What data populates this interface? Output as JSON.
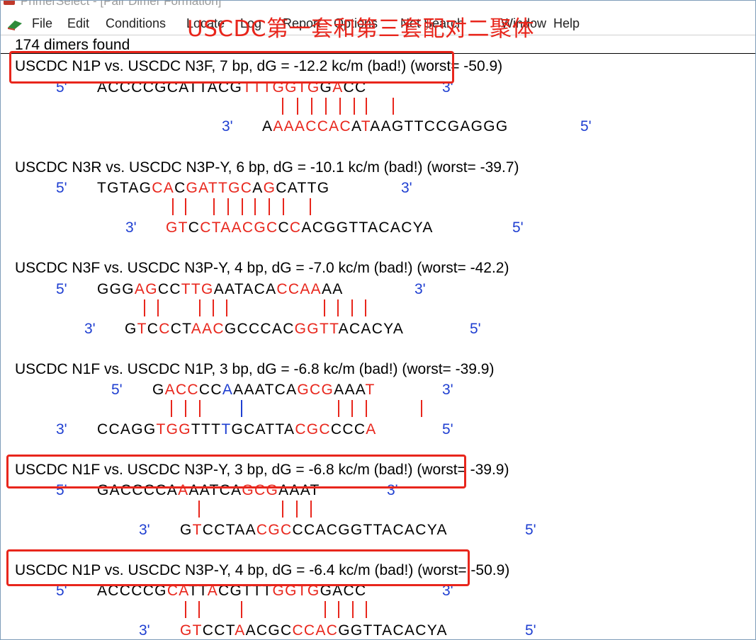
{
  "window": {
    "title": "PrimerSelect - [Pair Dimer Formation]"
  },
  "menu": {
    "items": [
      "File",
      "Edit",
      "Conditions",
      "Locate",
      "Log",
      "Report",
      "Options",
      "Net Search",
      "Window",
      "Help"
    ]
  },
  "annotation": {
    "text": "USCDC第一套和第三套配对二聚体",
    "color": "#e8261c"
  },
  "summary": "174 dimers found",
  "dimers": [
    {
      "header": "USCDC N1P vs. USCDC N3F, 7 bp, dG = -12.2 kc/m (bad!) (worst= -50.9)",
      "top": {
        "prime5": "5'",
        "prime3": "3'",
        "seq": "ACCCCGCATTACGTTTGGTGGACC"
      },
      "bottom": {
        "prime3": "3'",
        "prime5": "5'",
        "seq": "AAAACCACATAAGTTCCGAGGG"
      }
    },
    {
      "header": "USCDC N3R vs. USCDC N3P-Y, 6 bp, dG = -10.1 kc/m (bad!) (worst= -39.7)",
      "top": {
        "prime5": "5'",
        "prime3": "3'",
        "seq": "TGTAGCACGATTGCAGCATTG"
      },
      "bottom": {
        "prime3": "3'",
        "prime5": "5'",
        "seq": "GTCCTAACGCCCACGGTTACACYA"
      }
    },
    {
      "header": "USCDC N3F vs. USCDC N3P-Y, 4 bp, dG = -7.0 kc/m (bad!) (worst= -42.2)",
      "top": {
        "prime5": "5'",
        "prime3": "3'",
        "seq": "GGGAGCCTTGAATACACCAAAA"
      },
      "bottom": {
        "prime3": "3'",
        "prime5": "5'",
        "seq": "GTCCTAACGCCCACGGTTACACYA"
      }
    },
    {
      "header": "USCDC N1F vs. USCDC N1P, 3 bp, dG = -6.8 kc/m (bad!) (worst= -39.9)",
      "top": {
        "prime5": "5'",
        "prime3": "3'",
        "seq": "GACCCCAAAATCAGCGAAAT"
      },
      "bottom": {
        "prime3": "3'",
        "prime5": "5'",
        "seq": "CCAGGTGGTTTGCATTACGCCCCA"
      }
    },
    {
      "header": "USCDC N1F vs. USCDC N3P-Y, 3 bp, dG = -6.8 kc/m (bad!) (worst= -39.9)",
      "top": {
        "prime5": "5'",
        "prime3": "3'",
        "seq": "GACCCCAAAATCAGCGAAAT"
      },
      "bottom": {
        "prime3": "3'",
        "prime5": "5'",
        "seq": "GTCCTAACGCCCACGGTTACACYA"
      }
    },
    {
      "header": "USCDC N1P vs. USCDC N3P-Y, 4 bp, dG = -6.4 kc/m (bad!) (worst= -50.9)",
      "top": {
        "prime5": "5'",
        "prime3": "3'",
        "seq": "ACCCCGCATTACGTTTGGTGGACC"
      },
      "bottom": {
        "prime3": "3'",
        "prime5": "5'",
        "seq": "GTCCTAACGCCCACGGTTACACYA"
      }
    }
  ],
  "colors": {
    "mismatch": "#e8261c",
    "match": "#000000",
    "prime": "#1f3fd1",
    "highlight": "#e8261c"
  }
}
